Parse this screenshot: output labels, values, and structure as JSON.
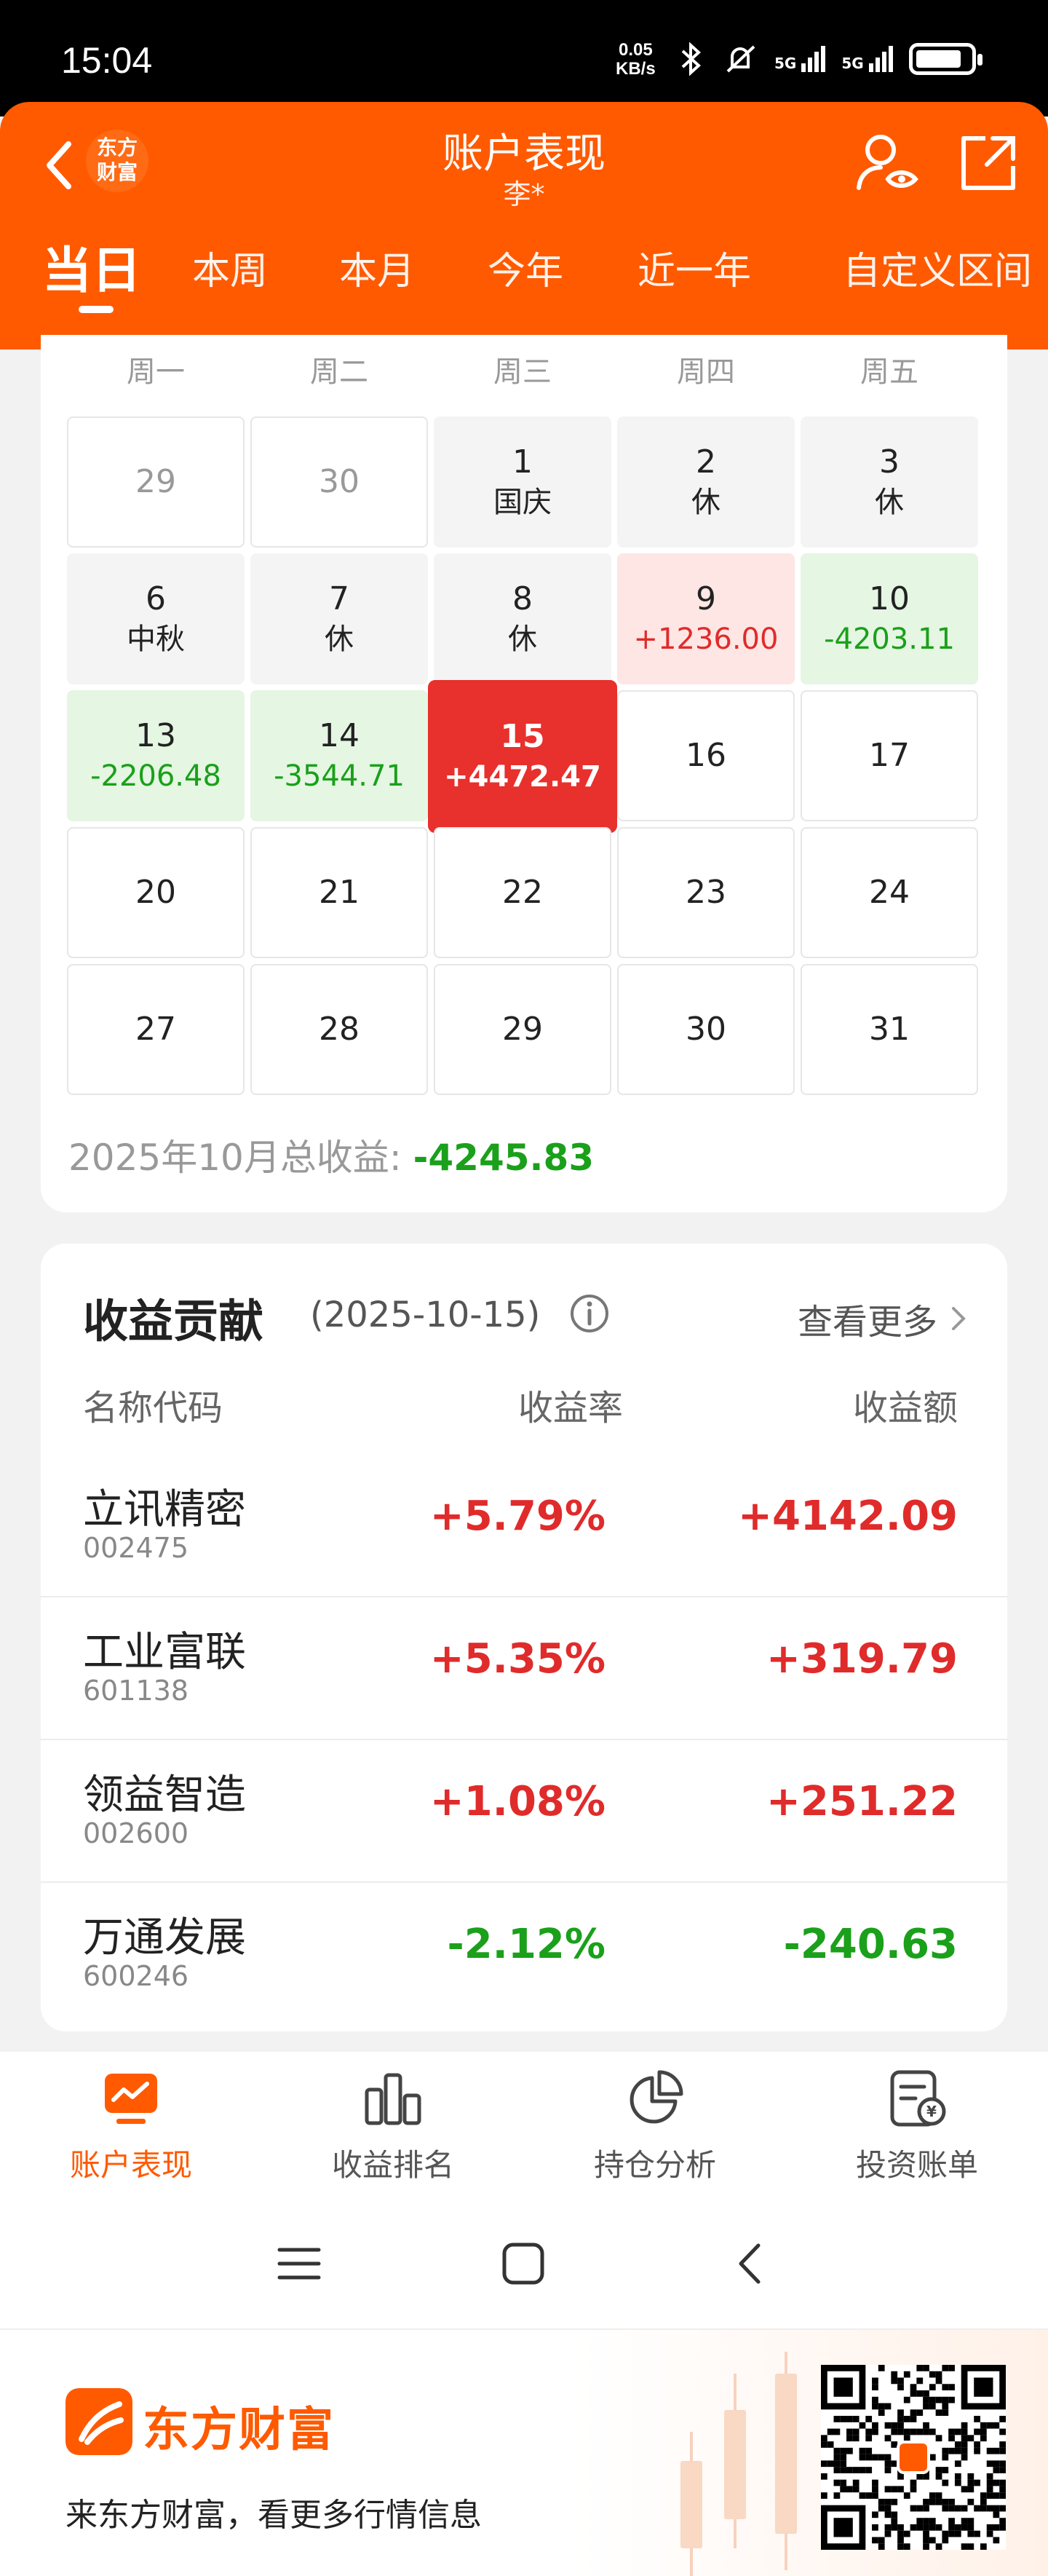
{
  "status_bar": {
    "time": "15:04",
    "net_speed": "0.05",
    "net_unit": "KB/s",
    "battery_level": 0.85,
    "signal": [
      "5G",
      "5G"
    ]
  },
  "header": {
    "logo_text_line1": "东方",
    "logo_text_line2": "财富",
    "title": "账户表现",
    "subtitle": "李*",
    "tabs": [
      "当日",
      "本周",
      "本月",
      "今年",
      "近一年",
      "自定义区间"
    ],
    "active_tab": 0
  },
  "calendar": {
    "weekdays": [
      "周一",
      "周二",
      "周三",
      "周四",
      "周五"
    ],
    "rows": [
      [
        {
          "day": "29",
          "sub": "",
          "kind": "prev"
        },
        {
          "day": "30",
          "sub": "",
          "kind": "prev"
        },
        {
          "day": "1",
          "sub": "国庆",
          "kind": "holiday"
        },
        {
          "day": "2",
          "sub": "休",
          "kind": "holiday"
        },
        {
          "day": "3",
          "sub": "休",
          "kind": "holiday"
        }
      ],
      [
        {
          "day": "6",
          "sub": "中秋",
          "kind": "holiday"
        },
        {
          "day": "7",
          "sub": "休",
          "kind": "holiday"
        },
        {
          "day": "8",
          "sub": "休",
          "kind": "holiday"
        },
        {
          "day": "9",
          "sub": "+1236.00",
          "kind": "up"
        },
        {
          "day": "10",
          "sub": "-4203.11",
          "kind": "down"
        }
      ],
      [
        {
          "day": "13",
          "sub": "-2206.48",
          "kind": "down"
        },
        {
          "day": "14",
          "sub": "-3544.71",
          "kind": "down"
        },
        {
          "day": "15",
          "sub": "+4472.47",
          "kind": "today"
        },
        {
          "day": "16",
          "sub": "",
          "kind": "normal"
        },
        {
          "day": "17",
          "sub": "",
          "kind": "normal"
        }
      ],
      [
        {
          "day": "20",
          "sub": "",
          "kind": "normal"
        },
        {
          "day": "21",
          "sub": "",
          "kind": "normal"
        },
        {
          "day": "22",
          "sub": "",
          "kind": "normal"
        },
        {
          "day": "23",
          "sub": "",
          "kind": "normal"
        },
        {
          "day": "24",
          "sub": "",
          "kind": "normal"
        }
      ],
      [
        {
          "day": "27",
          "sub": "",
          "kind": "normal"
        },
        {
          "day": "28",
          "sub": "",
          "kind": "normal"
        },
        {
          "day": "29",
          "sub": "",
          "kind": "normal"
        },
        {
          "day": "30",
          "sub": "",
          "kind": "normal"
        },
        {
          "day": "31",
          "sub": "",
          "kind": "normal"
        }
      ]
    ],
    "total_label": "2025年10月总收益:",
    "total_value": "-4245.83"
  },
  "contribution": {
    "title": "收益贡献",
    "date": "(2025-10-15)",
    "more_label": "查看更多",
    "col_name": "名称代码",
    "col_rate": "收益率",
    "col_amount": "收益额",
    "rows": [
      {
        "name": "立讯精密",
        "code": "002475",
        "rate": "+5.79%",
        "amount": "+4142.09",
        "dir": "pos"
      },
      {
        "name": "工业富联",
        "code": "601138",
        "rate": "+5.35%",
        "amount": "+319.79",
        "dir": "pos"
      },
      {
        "name": "领益智造",
        "code": "002600",
        "rate": "+1.08%",
        "amount": "+251.22",
        "dir": "pos"
      },
      {
        "name": "万通发展",
        "code": "600246",
        "rate": "-2.12%",
        "amount": "-240.63",
        "dir": "neg"
      }
    ]
  },
  "bottom_nav": {
    "items": [
      "账户表现",
      "收益排名",
      "持仓分析",
      "投资账单"
    ],
    "active": 0
  },
  "footer": {
    "brand": "东方财富",
    "slogan": "来东方财富，看更多行情信息"
  },
  "colors": {
    "brand_orange": "#ff5a00",
    "up_red": "#e02b2b",
    "down_green": "#1aa01a"
  }
}
